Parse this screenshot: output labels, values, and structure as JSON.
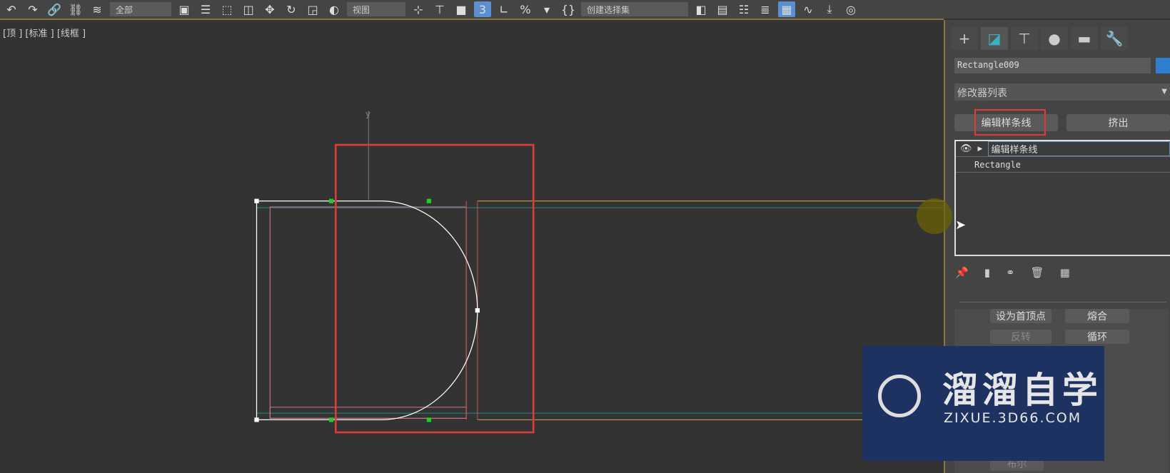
{
  "toolbar": {
    "selection_filter": "全部",
    "view_dropdown": "视图",
    "named_set": "创建选择集",
    "snap_value": "3"
  },
  "viewport": {
    "label": "[顶 ] [标准 ] [线框 ]",
    "axis_y": "y"
  },
  "panel": {
    "tabs": [
      "create",
      "modify",
      "hierarchy",
      "motion",
      "display",
      "utilities"
    ],
    "object_name": "Rectangle009",
    "object_color": "#2f7fd0",
    "modifier_list": "修改器列表",
    "quick_buttons": [
      "编辑样条线",
      "挤出"
    ],
    "stack": [
      {
        "label": "编辑样条线"
      },
      {
        "label": "Rectangle"
      }
    ],
    "rollout_buttons": [
      "设为首顶点",
      "熔合",
      "反转",
      "循环",
      "布尔"
    ]
  },
  "watermark": {
    "title": "溜溜自学",
    "url": "ZIXUE.3D66.COM"
  }
}
